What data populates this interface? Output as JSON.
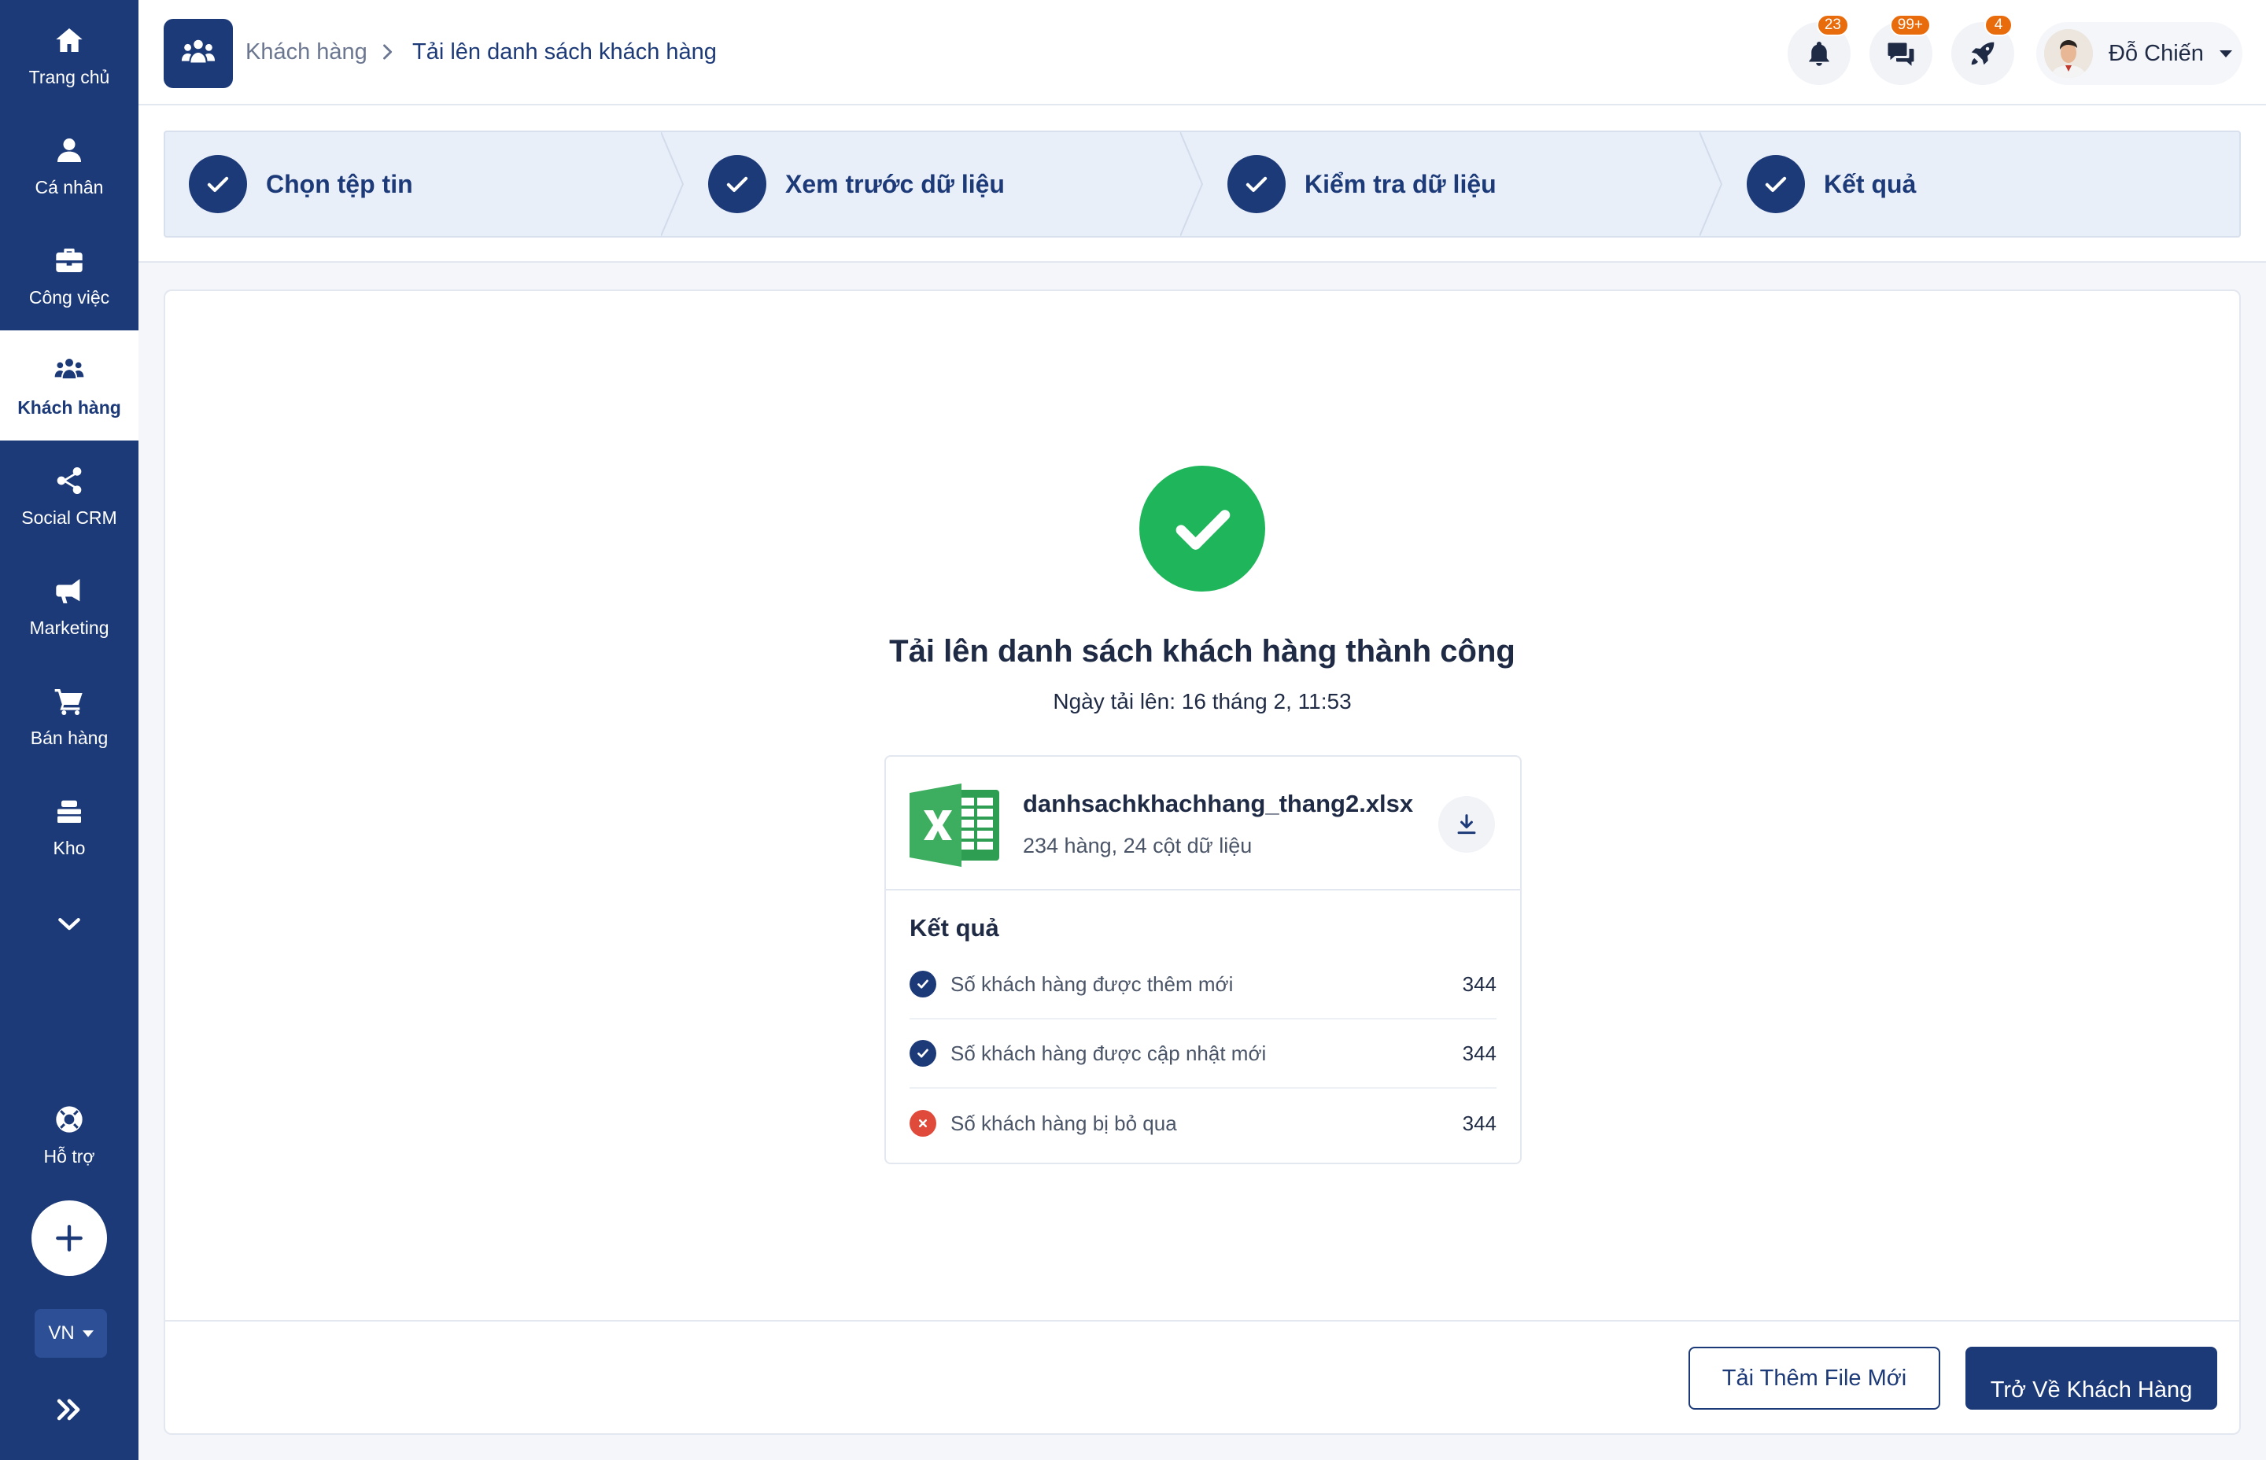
{
  "sidebar": {
    "items": [
      {
        "label": "Trang chủ",
        "icon": "home-icon"
      },
      {
        "label": "Cá nhân",
        "icon": "user-icon"
      },
      {
        "label": "Công việc",
        "icon": "briefcase-icon"
      },
      {
        "label": "Khách hàng",
        "icon": "users-icon"
      },
      {
        "label": "Social CRM",
        "icon": "share-icon"
      },
      {
        "label": "Marketing",
        "icon": "megaphone-icon"
      },
      {
        "label": "Bán hàng",
        "icon": "cart-icon"
      },
      {
        "label": "Kho",
        "icon": "warehouse-icon"
      }
    ],
    "active_index": 3,
    "support_label": "Hỗ trợ",
    "language": "VN"
  },
  "header": {
    "breadcrumb_parent": "Khách hàng",
    "breadcrumb_current": "Tải lên danh sách khách hàng",
    "notifications_badge": "23",
    "messages_badge": "99+",
    "updates_badge": "4",
    "user_name": "Đỗ Chiến"
  },
  "stepper": {
    "steps": [
      "Chọn tệp tin",
      "Xem trước dữ liệu",
      "Kiểm tra dữ liệu",
      "Kết quả"
    ]
  },
  "result": {
    "title": "Tải lên danh sách khách hàng thành công",
    "upload_date": "Ngày tải lên: 16 tháng 2, 11:53",
    "file_name": "danhsachkhachhang_thang2.xlsx",
    "file_meta": "234 hàng, 24 cột dữ liệu",
    "section_title": "Kết quả",
    "rows": [
      {
        "label": "Số khách hàng được thêm mới",
        "value": "344",
        "status": "success"
      },
      {
        "label": "Số khách hàng được cập nhật mới",
        "value": "344",
        "status": "success"
      },
      {
        "label": "Số khách hàng bị bỏ qua",
        "value": "344",
        "status": "error"
      }
    ]
  },
  "actions": {
    "upload_more": "Tải Thêm File Mới",
    "back_to_customers": "Trở Về Khách Hàng"
  },
  "colors": {
    "primary": "#1d3a78",
    "success": "#1fb65b",
    "error": "#e04a3b",
    "badge": "#e86b0c",
    "stepper_bg": "#e9eff9"
  }
}
